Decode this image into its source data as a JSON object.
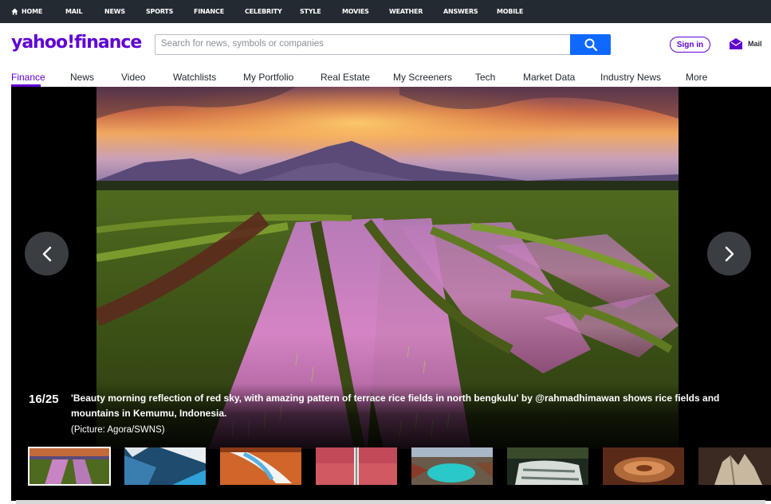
{
  "topbar": {
    "items": [
      "HOME",
      "MAIL",
      "NEWS",
      "SPORTS",
      "FINANCE",
      "CELEBRITY",
      "STYLE",
      "MOVIES",
      "WEATHER",
      "ANSWERS",
      "MOBILE"
    ]
  },
  "header": {
    "logo": "yahoo!finance",
    "search_placeholder": "Search for news, symbols or companies",
    "signin_label": "Sign in",
    "mail_label": "Mail"
  },
  "nav": {
    "items": [
      "Finance",
      "News",
      "Video",
      "Watchlists",
      "My Portfolio",
      "Real Estate",
      "My Screeners",
      "Tech",
      "Market Data",
      "Industry News",
      "More"
    ],
    "active": "Finance"
  },
  "slideshow": {
    "counter": "16/25",
    "caption": "'Beauty morning reflection of red sky, with amazing pattern of terrace rice fields in north bengkulu' by @rahmadhimawan shows rice fields and mountains in Kemumu, Indonesia.",
    "credit": "(Picture: Agora/SWNS)"
  },
  "thumbnails": [
    {
      "name": "rice-terrace",
      "selected": true
    },
    {
      "name": "lake-aerial",
      "selected": false
    },
    {
      "name": "white-terraces",
      "selected": false
    },
    {
      "name": "pink-road",
      "selected": false
    },
    {
      "name": "crater-lake",
      "selected": false
    },
    {
      "name": "waterfall",
      "selected": false
    },
    {
      "name": "dish",
      "selected": false
    },
    {
      "name": "rock-formation",
      "selected": false
    }
  ],
  "colors": {
    "brand": "#6001d2",
    "search_button": "#0f69ff",
    "topbar": "#232a31"
  }
}
